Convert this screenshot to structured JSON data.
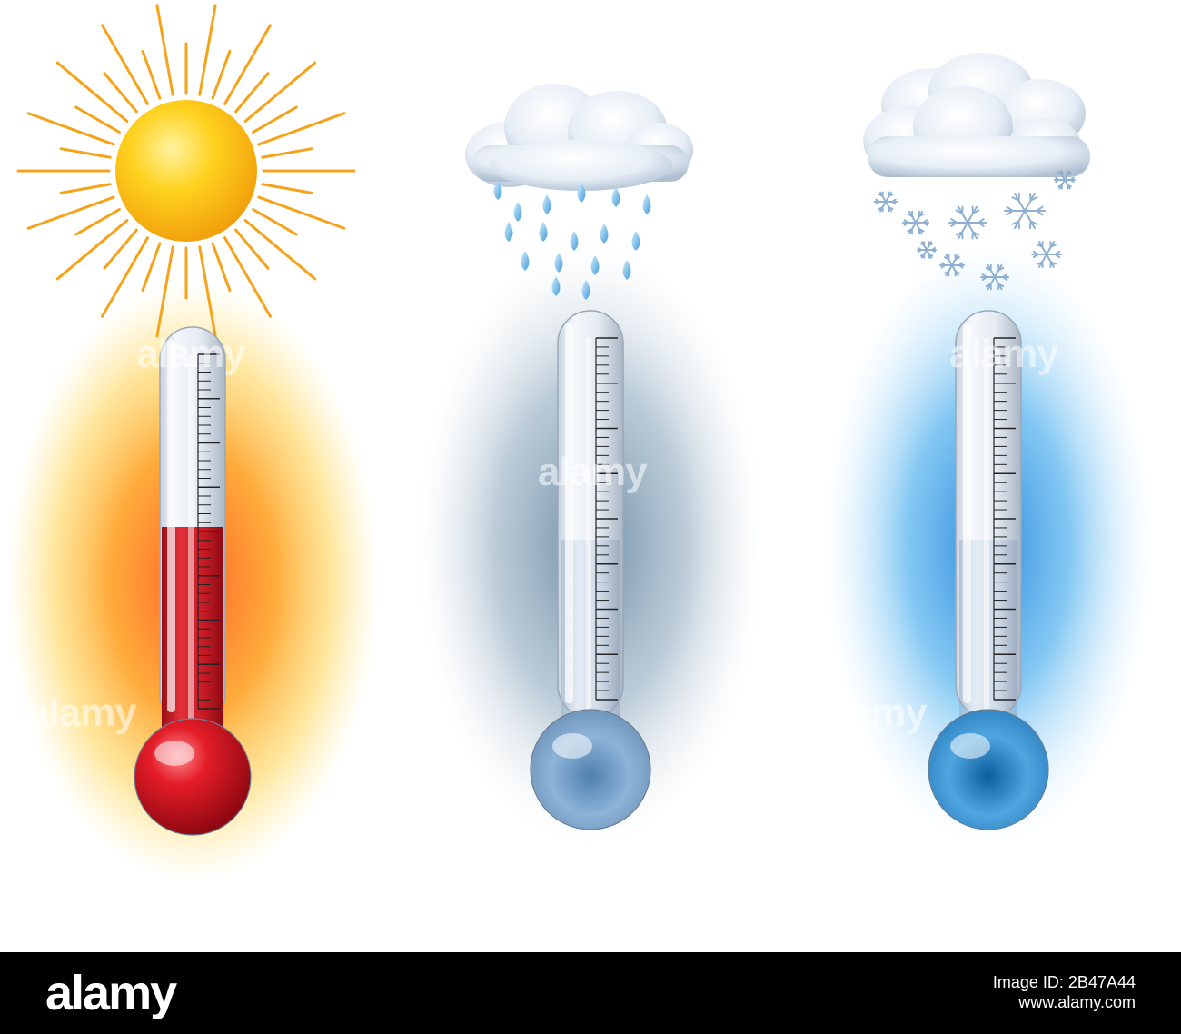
{
  "scenes": [
    {
      "weather": "sunny",
      "fill_level": 0.55,
      "liquid_color": "#d8222c",
      "glow_color": "#ff9d1a"
    },
    {
      "weather": "rain",
      "fill_level": 0.0,
      "liquid_color": "#7f9fc0",
      "glow_color": "#7d98ae"
    },
    {
      "weather": "snow",
      "fill_level": 0.0,
      "liquid_color": "#5aa6dc",
      "glow_color": "#2f9be6"
    }
  ],
  "watermark": {
    "text": "alamy",
    "letter": "a"
  },
  "footer": {
    "brand": "alamy",
    "image_id_label": "Image ID: 2B47A44",
    "site": "www.alamy.com"
  },
  "colors": {
    "sun": "#ffc21a",
    "ray": "#f4a31a",
    "cloud": "#dce8f4",
    "drop": "#7ec4ef",
    "snow": "#8fb0d0"
  }
}
